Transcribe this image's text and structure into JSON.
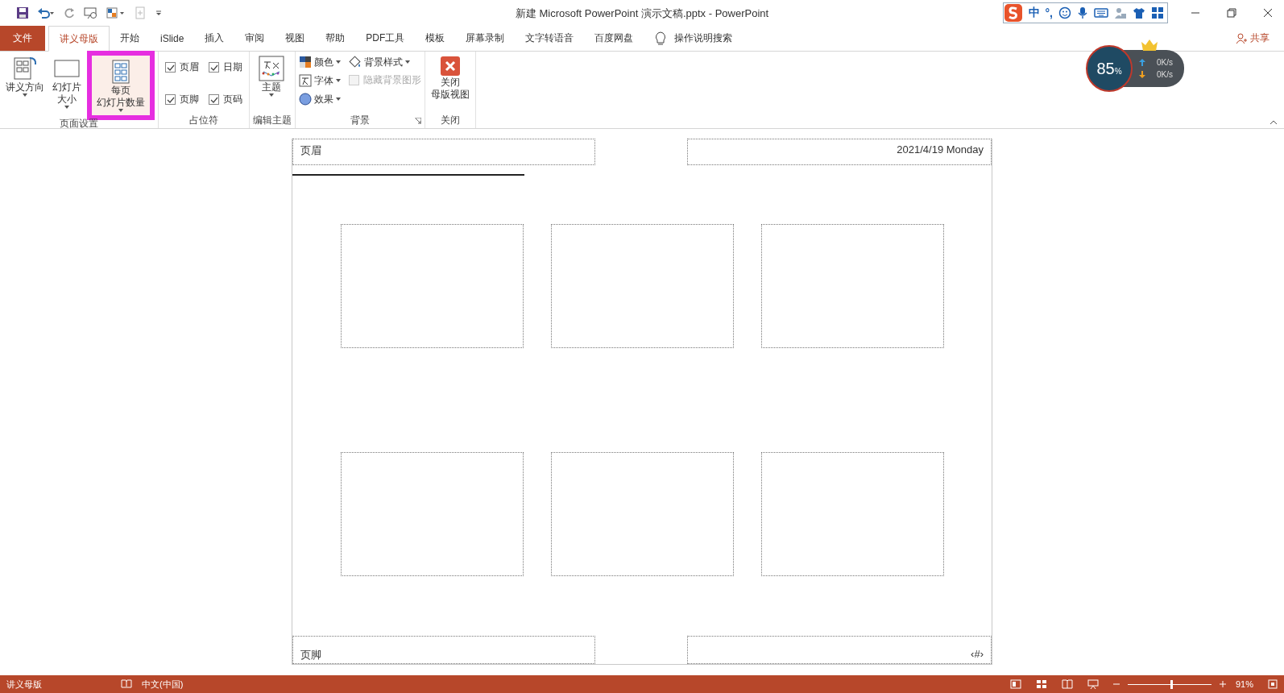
{
  "window": {
    "title": "新建 Microsoft PowerPoint 演示文稿.pptx  -  PowerPoint"
  },
  "ime": {
    "label": "中",
    "punct": "°,"
  },
  "tabs": [
    {
      "label": "文件",
      "kind": "file",
      "selected": false
    },
    {
      "label": "讲义母版",
      "kind": "tab",
      "selected": true
    },
    {
      "label": "开始",
      "kind": "tab",
      "selected": false
    },
    {
      "label": "iSlide",
      "kind": "tab",
      "selected": false
    },
    {
      "label": "插入",
      "kind": "tab",
      "selected": false
    },
    {
      "label": "审阅",
      "kind": "tab",
      "selected": false
    },
    {
      "label": "视图",
      "kind": "tab",
      "selected": false
    },
    {
      "label": "帮助",
      "kind": "tab",
      "selected": false
    },
    {
      "label": "PDF工具",
      "kind": "tab",
      "selected": false
    },
    {
      "label": "模板",
      "kind": "tab",
      "selected": false
    },
    {
      "label": "屏幕录制",
      "kind": "tab",
      "selected": false
    },
    {
      "label": "文字转语音",
      "kind": "tab",
      "selected": false
    },
    {
      "label": "百度网盘",
      "kind": "tab",
      "selected": false
    }
  ],
  "tell_me": "操作说明搜索",
  "share": "共享",
  "ribbon": {
    "page_setup": {
      "label": "页面设置",
      "buttons": [
        {
          "kind": "orientation",
          "lines": [
            "讲义方向"
          ],
          "highlighted": false
        },
        {
          "kind": "size",
          "lines": [
            "幻灯片",
            "大小"
          ],
          "highlighted": false
        },
        {
          "kind": "per_page",
          "lines": [
            "每页",
            "幻灯片数量"
          ],
          "highlighted": true
        }
      ]
    },
    "placeholders": {
      "label": "占位符",
      "checkboxes": [
        {
          "label": "页眉",
          "checked": true
        },
        {
          "label": "日期",
          "checked": true
        },
        {
          "label": "页脚",
          "checked": true
        },
        {
          "label": "页码",
          "checked": true
        }
      ]
    },
    "edit_theme": {
      "label": "编辑主题",
      "button": "主题"
    },
    "background": {
      "label": "背景",
      "items": [
        {
          "kind": "colors",
          "label": "颜色"
        },
        {
          "kind": "fonts",
          "label": "字体"
        },
        {
          "kind": "effects",
          "label": "效果"
        }
      ],
      "style": "背景样式",
      "hide": {
        "label": "隐藏背景图形",
        "checked": false,
        "disabled": true
      }
    },
    "close": {
      "label": "关闭",
      "lines": [
        "关闭",
        "母版视图"
      ]
    }
  },
  "speed_widget": {
    "percent": "85",
    "unit": "%",
    "up": "0K/s",
    "down": "0K/s"
  },
  "handout": {
    "header": "页眉",
    "date": "2021/4/19 Monday",
    "footer": "页脚",
    "page_number": "‹#›",
    "slots": [
      {
        "kind": "slide"
      },
      {
        "kind": "slide"
      },
      {
        "kind": "slide"
      },
      {
        "kind": "slide"
      },
      {
        "kind": "slide"
      },
      {
        "kind": "slide"
      }
    ]
  },
  "status_bar": {
    "mode": "讲义母版",
    "language": "中文(中国)",
    "zoom": "91%",
    "zoom_slider": {
      "level": 0.52
    }
  }
}
